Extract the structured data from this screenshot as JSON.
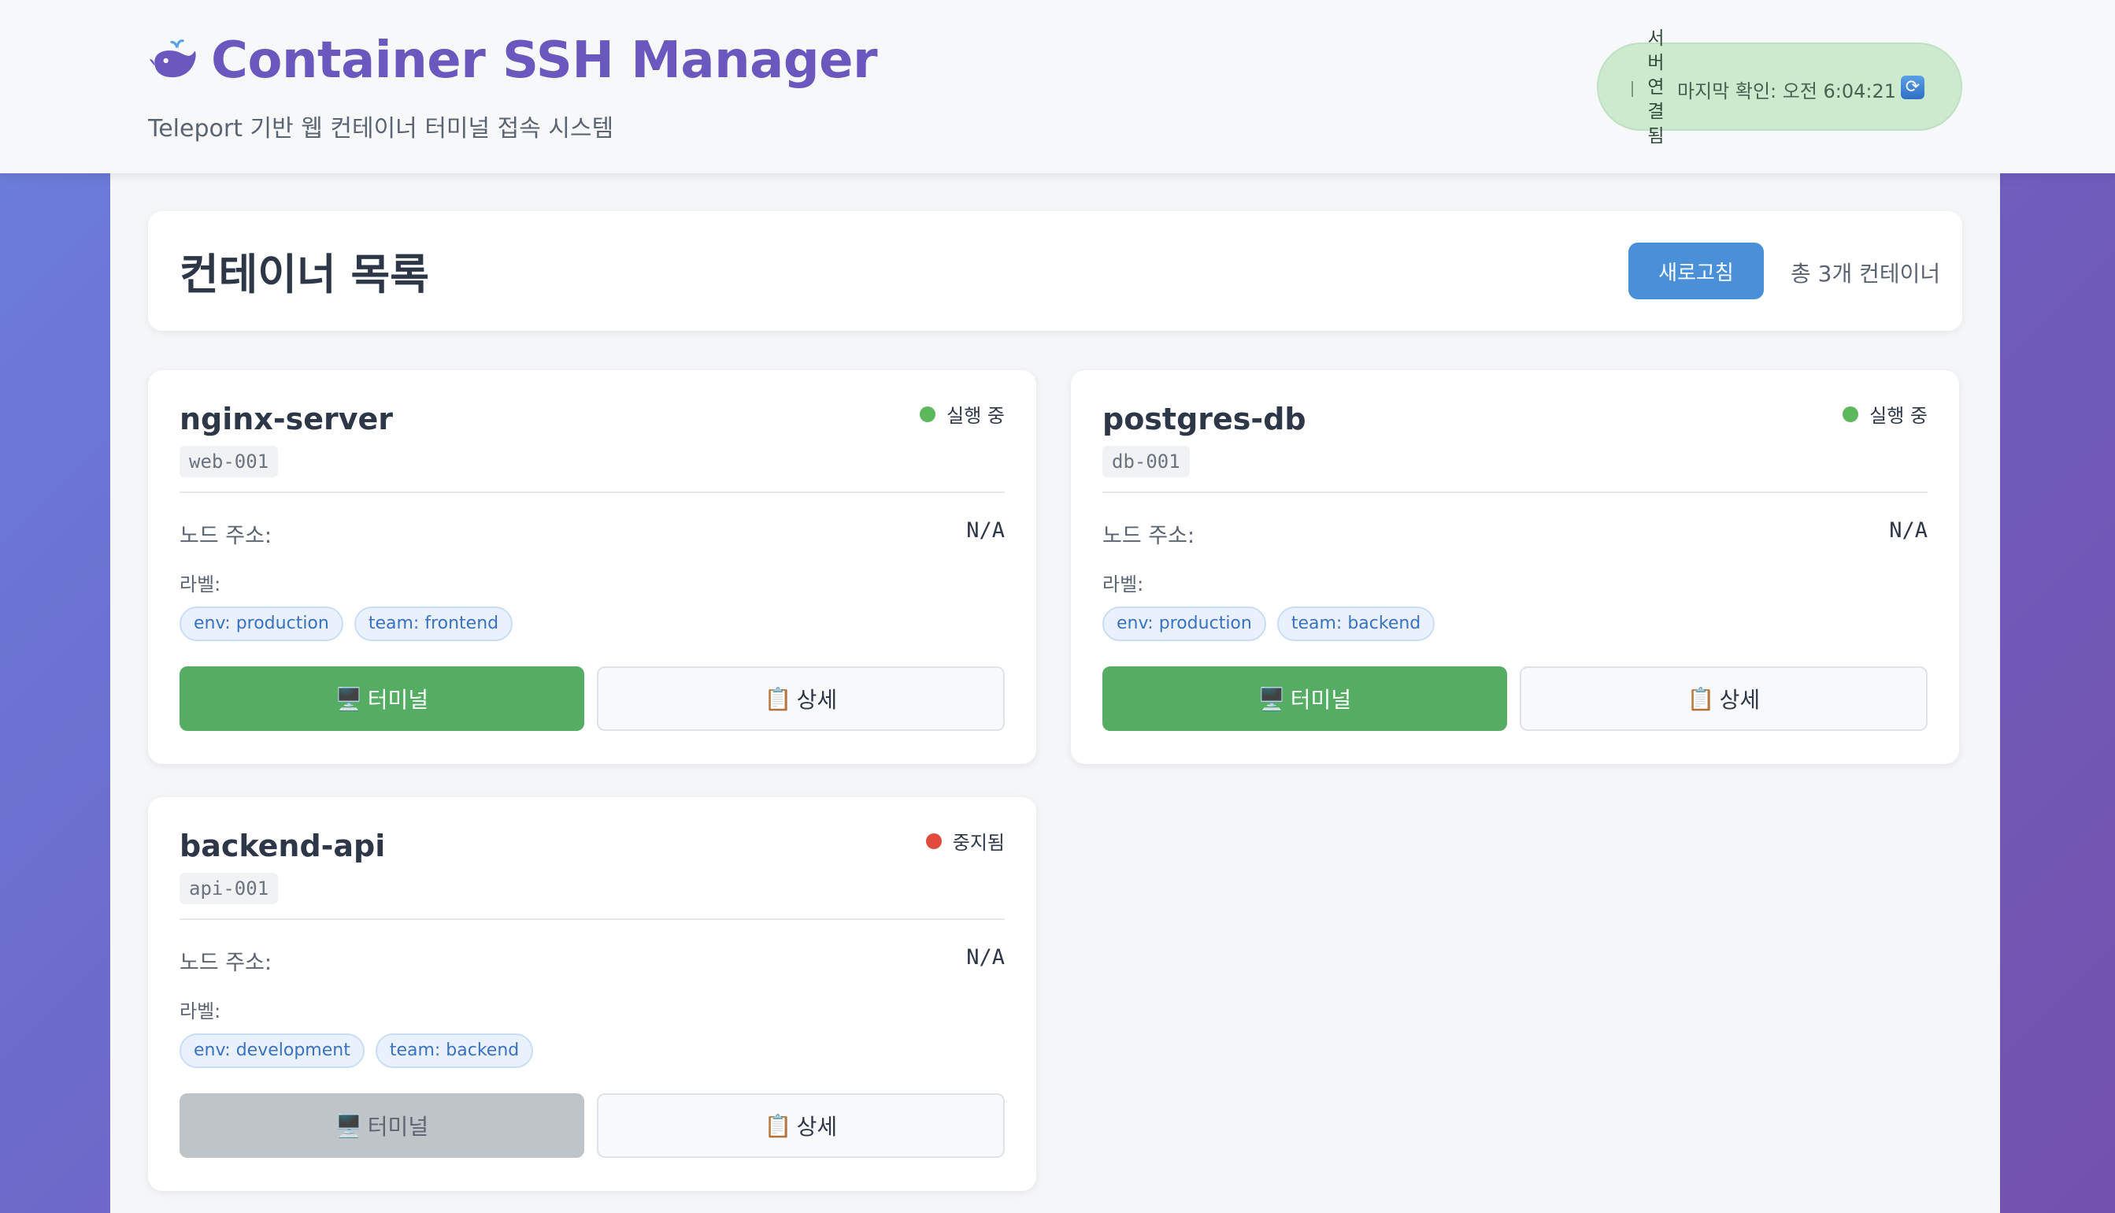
{
  "header": {
    "title": "Container SSH Manager",
    "subtitle": "Teleport 기반 웹 컨테이너 터미널 접속 시스템",
    "status": {
      "connection": "서버연결됨",
      "last_check": "마지막 확인: 오전 6:04:21",
      "icon": "refresh-icon"
    }
  },
  "list": {
    "title": "컨테이너 목록",
    "refresh_label": "새로고침",
    "total": "총 3개 컨테이너"
  },
  "common": {
    "node_label": "노드 주소:",
    "labels_title": "라벨:",
    "terminal_label": "터미널",
    "detail_label": "상세",
    "terminal_icon": "🖥️",
    "detail_icon": "📋"
  },
  "containers": [
    {
      "name": "nginx-server",
      "id": "web-001",
      "state": "실행 중",
      "state_color": "#5cb85c",
      "node": "N/A",
      "tags": [
        "env: production",
        "team: frontend"
      ]
    },
    {
      "name": "postgres-db",
      "id": "db-001",
      "state": "실행 중",
      "state_color": "#5cb85c",
      "node": "N/A",
      "tags": [
        "env: production",
        "team: backend"
      ]
    },
    {
      "name": "backend-api",
      "id": "api-001",
      "state": "중지됨",
      "state_color": "#e04b3c",
      "node": "N/A",
      "tags": [
        "env: development",
        "team: backend"
      ]
    }
  ],
  "colors": {
    "accent": "#4a90d9",
    "running": "#5cb85c",
    "stopped": "#e04b3c",
    "terminal_button": "#55ac63"
  }
}
